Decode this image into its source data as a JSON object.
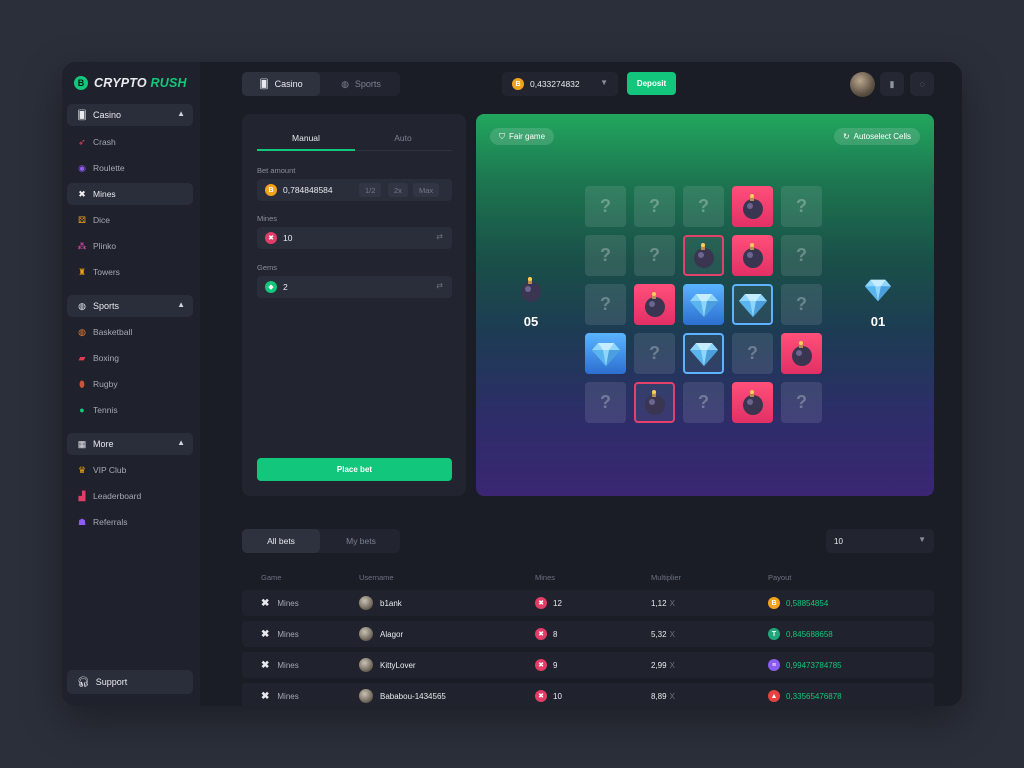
{
  "logo": {
    "coin": "B",
    "crypto": "CRYPTO",
    "rush": "RUSH"
  },
  "sidebar": {
    "casino": {
      "label": "Casino",
      "icon": "cards-icon"
    },
    "casino_items": [
      {
        "label": "Crash",
        "icon": "rocket-icon"
      },
      {
        "label": "Roulette",
        "icon": "roulette-icon"
      },
      {
        "label": "Mines",
        "icon": "mines-icon"
      },
      {
        "label": "Dice",
        "icon": "dice-icon"
      },
      {
        "label": "Plinko",
        "icon": "plinko-icon"
      },
      {
        "label": "Towers",
        "icon": "tower-icon"
      }
    ],
    "sports": {
      "label": "Sports",
      "icon": "ball-icon"
    },
    "sports_items": [
      {
        "label": "Basketball",
        "icon": "basketball-icon"
      },
      {
        "label": "Boxing",
        "icon": "boxing-glove-icon"
      },
      {
        "label": "Rugby",
        "icon": "rugby-icon"
      },
      {
        "label": "Tennis",
        "icon": "tennis-icon"
      }
    ],
    "more": {
      "label": "More",
      "icon": "grid-icon"
    },
    "more_items": [
      {
        "label": "VIP Club",
        "icon": "crown-icon"
      },
      {
        "label": "Leaderboard",
        "icon": "bar-chart-icon"
      },
      {
        "label": "Referrals",
        "icon": "user-icon"
      }
    ],
    "support": "Support"
  },
  "topbar": {
    "tabs": [
      {
        "label": "Casino"
      },
      {
        "label": "Sports"
      }
    ],
    "balance": "0,433274832",
    "deposit": "Deposit"
  },
  "bet_panel": {
    "modes": [
      "Manual",
      "Auto"
    ],
    "bet_amount_label": "Bet amount",
    "bet_amount": "0,784848584",
    "chips": [
      "1/2",
      "2x",
      "Max"
    ],
    "mines_label": "Mines",
    "mines_value": "10",
    "gems_label": "Gems",
    "gems_value": "2",
    "place_bet": "Place bet"
  },
  "game": {
    "fair_game": "Fair game",
    "autoselect": "Autoselect Cells",
    "mines_count": "05",
    "gems_count": "01",
    "hidden_mark": "?",
    "grid": [
      [
        "hidden",
        "hidden",
        "hidden",
        "bomb",
        "hidden"
      ],
      [
        "hidden",
        "hidden",
        "bomb-out",
        "bomb",
        "hidden"
      ],
      [
        "hidden",
        "bomb",
        "gem",
        "gem-out",
        "hidden"
      ],
      [
        "gem",
        "hidden",
        "gem-out",
        "hidden",
        "bomb"
      ],
      [
        "hidden",
        "bomb-out",
        "hidden",
        "bomb",
        "hidden"
      ]
    ]
  },
  "bets": {
    "tabs": [
      "All bets",
      "My bets"
    ],
    "count": "10",
    "columns": [
      "Game",
      "Username",
      "Mines",
      "Multiplier",
      "Payout"
    ],
    "rows": [
      {
        "game": "Mines",
        "user": "b1ank",
        "mines": "12",
        "mult": "1,12",
        "x": "X",
        "payout": "0,58854854",
        "coin": "btc",
        "coin_color": "#f2a31b",
        "coin_glyph": "B"
      },
      {
        "game": "Mines",
        "user": "Alagor",
        "mines": "8",
        "mult": "5,32",
        "x": "X",
        "payout": "0,845688658",
        "coin": "tether",
        "coin_color": "#1fa67a",
        "coin_glyph": "T"
      },
      {
        "game": "Mines",
        "user": "KittyLover",
        "mines": "9",
        "mult": "2,99",
        "x": "X",
        "payout": "0,99473784785",
        "coin": "solana",
        "coin_color": "#8a5cf0",
        "coin_glyph": "≡"
      },
      {
        "game": "Mines",
        "user": "Bababou-1434565",
        "mines": "10",
        "mult": "8,89",
        "x": "X",
        "payout": "0,33565476878",
        "coin": "avax",
        "coin_color": "#e84142",
        "coin_glyph": "▲"
      }
    ]
  },
  "colors": {
    "accent": "#12c77b",
    "mine": "#e23c67",
    "btc": "#f2a31b"
  }
}
